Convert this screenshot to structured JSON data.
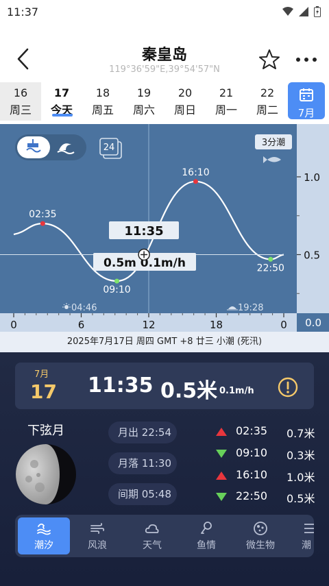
{
  "status": {
    "time": "11:37"
  },
  "header": {
    "title": "秦皇岛",
    "coords": "119°36'59\"E,39°54'57\"N"
  },
  "dates": [
    {
      "day": "16",
      "weekday": "周三",
      "state": "past"
    },
    {
      "day": "17",
      "weekday": "今天",
      "state": "today"
    },
    {
      "day": "18",
      "weekday": "周五",
      "state": ""
    },
    {
      "day": "19",
      "weekday": "周六",
      "state": ""
    },
    {
      "day": "20",
      "weekday": "周日",
      "state": ""
    },
    {
      "day": "21",
      "weekday": "周一",
      "state": ""
    },
    {
      "day": "22",
      "weekday": "周二",
      "state": ""
    }
  ],
  "month_button": {
    "label": "7月"
  },
  "chart_controls": {
    "hours_badge": "24",
    "tide_level_badge": "3分潮"
  },
  "chart_data": {
    "type": "line",
    "x": [
      0,
      2.58,
      9.17,
      16.17,
      22.83,
      24
    ],
    "y": [
      0.63,
      0.7,
      0.33,
      0.97,
      0.47,
      0.5
    ],
    "xlim": [
      0,
      24
    ],
    "ylim": [
      0.0,
      1.25
    ],
    "x_ticks": [
      "0",
      "6",
      "12",
      "18",
      "0"
    ],
    "x_tick_values": [
      0,
      6,
      12,
      18,
      24
    ],
    "y_ticks": [
      "1.0",
      "0.5",
      "0.0"
    ],
    "y_tick_values": [
      1.0,
      0.5,
      0.0
    ],
    "extremes": [
      {
        "label": "02:35",
        "x": 2.58,
        "y": 0.7,
        "type": "high"
      },
      {
        "label": "09:10",
        "x": 9.17,
        "y": 0.33,
        "type": "low"
      },
      {
        "label": "16:10",
        "x": 16.17,
        "y": 0.97,
        "type": "high"
      },
      {
        "label": "22:50",
        "x": 22.83,
        "y": 0.47,
        "type": "low"
      }
    ],
    "cursor": {
      "x": 11.58,
      "y": 0.5,
      "time_label": "11:35",
      "value_label": "0.5m  0.1m/h"
    },
    "sunrise": "04:46",
    "sunset": "19:28",
    "colors": {
      "background": "#4b739f",
      "axis_panel": "#cad8ea",
      "curve": "#ffffff",
      "high_marker": "#e8363d",
      "low_marker": "#7ee36b"
    }
  },
  "chart_info": "2025年7月17日  周四  GMT +8  廿三  小潮 (死汛)",
  "now_card": {
    "month": "7月",
    "day": "17",
    "time": "11:35",
    "height": "0.5米",
    "rate": "0.1m/h"
  },
  "moon": {
    "phase": "下弦月",
    "rise": "月出 22:54",
    "set": "月落 11:30",
    "interval": "间期 05:48"
  },
  "tides": [
    {
      "dir": "up",
      "time": "02:35",
      "height": "0.7米"
    },
    {
      "dir": "down",
      "time": "09:10",
      "height": "0.3米"
    },
    {
      "dir": "up",
      "time": "16:10",
      "height": "1.0米"
    },
    {
      "dir": "down",
      "time": "22:50",
      "height": "0.5米"
    }
  ],
  "tabs": [
    {
      "label": "潮汐",
      "icon": "tide-icon",
      "active": true
    },
    {
      "label": "风浪",
      "icon": "wind-icon",
      "active": false
    },
    {
      "label": "天气",
      "icon": "cloud-icon",
      "active": false
    },
    {
      "label": "鱼情",
      "icon": "fish-icon",
      "active": false
    },
    {
      "label": "微生物",
      "icon": "microbe-icon",
      "active": false
    },
    {
      "label": "潮",
      "icon": "list-icon",
      "active": false
    }
  ]
}
